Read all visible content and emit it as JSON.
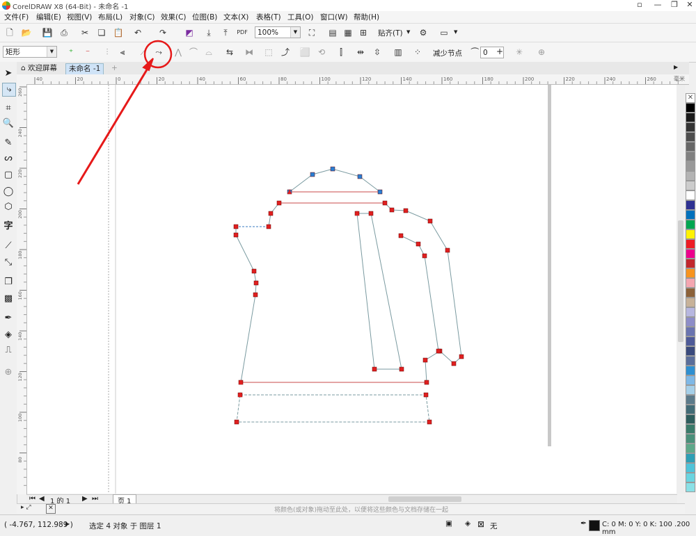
{
  "title": "CorelDRAW X8 (64-Bit) - 未命名 -1",
  "menu": [
    "文件(F)",
    "编辑(E)",
    "视图(V)",
    "布局(L)",
    "对象(C)",
    "效果(C)",
    "位图(B)",
    "文本(X)",
    "表格(T)",
    "工具(O)",
    "窗口(W)",
    "帮助(H)"
  ],
  "toolbar": {
    "zoom_value": "100%",
    "snap_label": "贴齐(T)",
    "pdf_label": "PDF"
  },
  "property_bar": {
    "shape_type": "矩形",
    "reduce_nodes_label": "减少节点",
    "curve_smoothness": "0"
  },
  "tabs": {
    "welcome": "欢迎屏幕",
    "document": "未命名 -1"
  },
  "ruler": {
    "h_labels": [
      "40",
      "20",
      "0",
      "20",
      "40",
      "60",
      "80",
      "100",
      "120",
      "140",
      "160",
      "180",
      "200",
      "220",
      "240",
      "260"
    ],
    "unit": "毫米",
    "v_labels": [
      "260",
      "240",
      "220",
      "200",
      "180",
      "160",
      "140",
      "120",
      "100",
      "80"
    ]
  },
  "page_nav": {
    "count_text": "1 的 1",
    "page_label": "页 1"
  },
  "color_bar_hint": "将颜色(或对象)拖动至此处，以便将这些颜色与文档存储在一起",
  "status": {
    "coords": "( -4.767, 112.989 )",
    "selection": "选定 4 对象 于 图层 1",
    "fill_label": "无",
    "outline_text": "C: 0 M: 0 Y: 0 K: 100  .200 mm"
  },
  "colors": {
    "node_red": "#e02020",
    "node_blue": "#2a7fd4",
    "annotation_red": "#e61919",
    "path_line": "#7a9aa0"
  },
  "palette": [
    "#000000",
    "#1a1a1a",
    "#333333",
    "#4d4d4d",
    "#666666",
    "#808080",
    "#999999",
    "#b3b3b3",
    "#cccccc",
    "#ffffff",
    "#2e3192",
    "#0071bc",
    "#00a651",
    "#fff200",
    "#ed1c24",
    "#ec008c",
    "#c1272d",
    "#f7931e",
    "#f4a6b0",
    "#8c6239",
    "#c7b299",
    "#b7b7e0",
    "#8d8dc8",
    "#6a74b0",
    "#4e5a98",
    "#3a4a7c",
    "#5b6e9a",
    "#2f8fd0",
    "#7fb8e6",
    "#a6cfe8",
    "#5c7a8a",
    "#426b76",
    "#2e5d5d",
    "#3a7a6a",
    "#4a8f7a",
    "#5ea88a",
    "#2e9fb5",
    "#4fc3d9",
    "#6ad4e0",
    "#8ae0e6"
  ]
}
